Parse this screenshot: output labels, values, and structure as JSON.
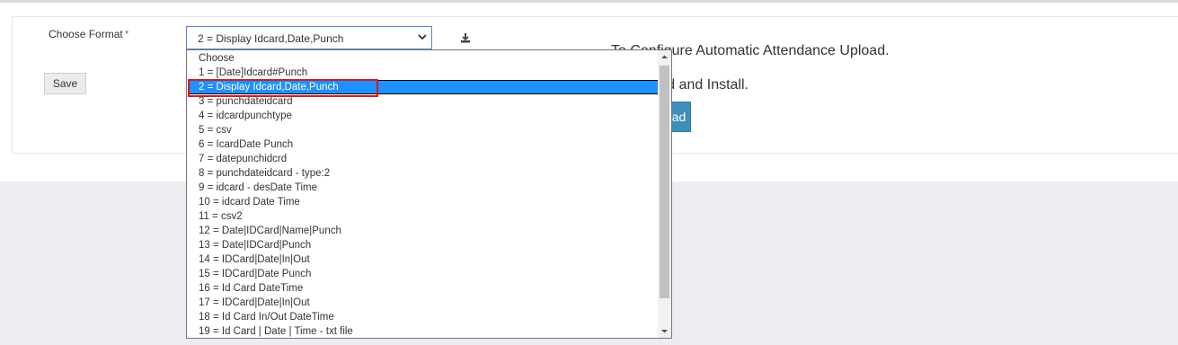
{
  "form": {
    "choose_format_label": "Choose Format",
    "required_mark": "*",
    "selected_value": "2 = Display Idcard,Date,Punch",
    "save_label": "Save"
  },
  "info": {
    "line1": "To Configure Automatic Attendance Upload.",
    "line2": "Download and Install.",
    "button_label": "Download"
  },
  "dropdown": {
    "selected_index": 2,
    "options": [
      "Choose",
      "1 = [Date]Idcard#Punch",
      "2 = Display Idcard,Date,Punch",
      "3 = punchdateidcard",
      "4 = idcardpunchtype",
      "5 = csv",
      "6 = IcardDate Punch",
      "7 = datepunchidcrd",
      "8 = punchdateidcard - type:2",
      "9 = idcard - desDate Time",
      "10 = idcard Date Time",
      "11 = csv2",
      "12 = Date|IDCard|Name|Punch",
      "13 = Date|IDCard|Punch",
      "14 = IDCard|Date|In|Out",
      "15 = IDCard|Date Punch",
      "16 = Id Card DateTime",
      "17 = IDCard|Date|In|Out",
      "18 = Id Card In/Out DateTime",
      "19 = Id Card | Date | Time - txt file"
    ]
  },
  "icons": {
    "download": "download-icon",
    "chevron": "chevron-down-icon"
  },
  "colors": {
    "selected_bg": "#1e90ff",
    "annotation": "#d9171e",
    "primary_button": "#3d8eb9",
    "required": "#d9534f"
  }
}
